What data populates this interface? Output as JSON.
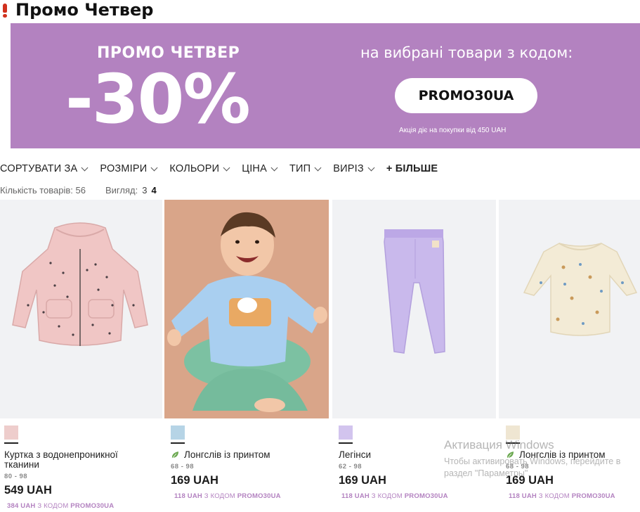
{
  "heading": {
    "title": "Промо Четвер"
  },
  "banner": {
    "subtitle": "ПРОМО ЧЕТВЕР",
    "discount": "-30%",
    "right_text": "на вибрані товари з кодом:",
    "code": "PROMO30UA",
    "note": "Акція діє на покупки від 450 UAH",
    "color": "#b382c0"
  },
  "filters": [
    {
      "label": "СОРТУВАТИ ЗА"
    },
    {
      "label": "РОЗМІРИ"
    },
    {
      "label": "КОЛЬОРИ"
    },
    {
      "label": "ЦІНА"
    },
    {
      "label": "ТИП"
    },
    {
      "label": "ВИРІЗ"
    }
  ],
  "more_filters": "+ БІЛЬШЕ",
  "counts": {
    "label": "Кількість товарів:",
    "value": "56",
    "view_label": "Вигляд:",
    "view_opt1": "3",
    "view_opt2": "4"
  },
  "products": [
    {
      "name": "Куртка з водонепроникної тканини",
      "size": "80 - 98",
      "price": "549 UAH",
      "promo_price": "384 UAH",
      "promo_mid": "З КОДОМ",
      "promo_code": "PROMO30UA",
      "swatch": "#eecdcc"
    },
    {
      "name": "Лонгслів із принтом",
      "size": "68 - 98",
      "price": "169 UAH",
      "promo_price": "118 UAH",
      "promo_mid": "З КОДОМ",
      "promo_code": "PROMO30UA",
      "swatch": "#b6d4e6",
      "icon": "leaf-icon"
    },
    {
      "name": "Легінси",
      "size": "62 - 98",
      "price": "169 UAH",
      "promo_price": "118 UAH",
      "promo_mid": "З КОДОМ",
      "promo_code": "PROMO30UA",
      "swatch": "#d2c4ee"
    },
    {
      "name": "Лонгслів із принтом",
      "size": "68 - 98",
      "price": "169 UAH",
      "promo_price": "118 UAH",
      "promo_mid": "З КОДОМ",
      "promo_code": "PROMO30UA",
      "swatch": "#efe6d2",
      "icon": "leaf-icon"
    }
  ],
  "watermark": {
    "line1": "Активация Windows",
    "line2": "Чтобы активировать Windows, перейдите в",
    "line3": "раздел \"Параметры\"."
  }
}
